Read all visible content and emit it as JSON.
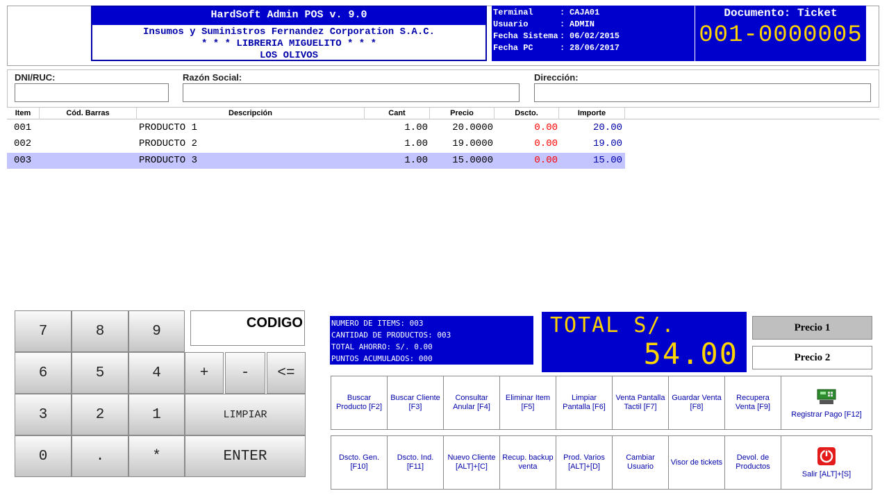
{
  "header": {
    "title": "HardSoft Admin POS v. 9.0",
    "lines": [
      "Insumos y Suministros Fernandez Corporation S.A.C.",
      "* * * LIBRERIA MIGUELITO * * *",
      "LOS OLIVOS"
    ],
    "info": [
      {
        "key": "Terminal",
        "value": "CAJA01"
      },
      {
        "key": "Usuario",
        "value": "ADMIN"
      },
      {
        "key": "Fecha Sistema",
        "value": "06/02/2015"
      },
      {
        "key": "Fecha PC",
        "value": "28/06/2017"
      }
    ],
    "doc_label": "Documento: Ticket",
    "doc_number": "001-0000005"
  },
  "customer": {
    "dni_label": "DNI/RUC:",
    "razon_label": "Razón Social:",
    "direccion_label": "Dirección:",
    "dni_value": "",
    "razon_value": "",
    "direccion_value": ""
  },
  "table": {
    "columns": [
      "Item",
      "Cód. Barras",
      "Descripción",
      "Cant",
      "Precio",
      "Dscto.",
      "Importe"
    ],
    "rows": [
      {
        "item": "001",
        "barcode": "",
        "desc": "PRODUCTO 1",
        "cant": "1.00",
        "precio": "20.0000",
        "dscto": "0.00",
        "importe": "20.00"
      },
      {
        "item": "002",
        "barcode": "",
        "desc": "PRODUCTO 2",
        "cant": "1.00",
        "precio": "19.0000",
        "dscto": "0.00",
        "importe": "19.00"
      },
      {
        "item": "003",
        "barcode": "",
        "desc": "PRODUCTO 3",
        "cant": "1.00",
        "precio": "15.0000",
        "dscto": "0.00",
        "importe": "15.00"
      }
    ]
  },
  "keypad": {
    "keys": [
      "7",
      "8",
      "9",
      "6",
      "5",
      "4",
      "3",
      "2",
      "1",
      "0",
      ".",
      "*"
    ],
    "plus": "+",
    "minus": "-",
    "back": "<=",
    "limpiar": "LIMPIAR",
    "enter": "ENTER",
    "codigo_label": "CODIGO"
  },
  "summary": {
    "items": "NUMERO DE ITEMS: 003",
    "cantidad": "CANTIDAD DE PRODUCTOS: 003",
    "ahorro": "TOTAL AHORRO: S/. 0.00",
    "puntos": "PUNTOS ACUMULADOS: 000"
  },
  "total": {
    "label": "TOTAL S/.",
    "value": "54.00"
  },
  "prices": {
    "precio1": "Precio 1",
    "precio2": "Precio 2"
  },
  "functions": {
    "buscar_producto": "Buscar Producto [F2]",
    "buscar_cliente": "Buscar Cliente [F3]",
    "consultar_anular": "Consultar Anular [F4]",
    "eliminar_item": "Eliminar Item [F5]",
    "limpiar_pantalla": "Limpiar Pantalla [F6]",
    "venta_tactil": "Venta Pantalla Tactil [F7]",
    "guardar_venta": "Guardar Venta [F8]",
    "recupera_venta": "Recupera Venta [F9]",
    "registrar_pago": "Registrar Pago [F12]",
    "dscto_gen": "Dscto. Gen. [F10]",
    "dscto_ind": "Dscto. Ind. [F11]",
    "nuevo_cliente": "Nuevo Cliente [ALT]+[C]",
    "recup_backup": "Recup. backup venta",
    "prod_varios": "Prod. Varios [ALT]+[D]",
    "cambiar_usuario": "Cambiar Usuario",
    "visor_tickets": "Visor de tickets",
    "devol_productos": "Devol. de Productos",
    "salir": "Salir [ALT]+[S]"
  },
  "colors": {
    "panel_blue": "#0000cc",
    "digit_yellow": "#ffd400",
    "discount_red": "#ff0000",
    "amount_blue": "#0000aa",
    "selected_row": "#c4c4ff"
  }
}
